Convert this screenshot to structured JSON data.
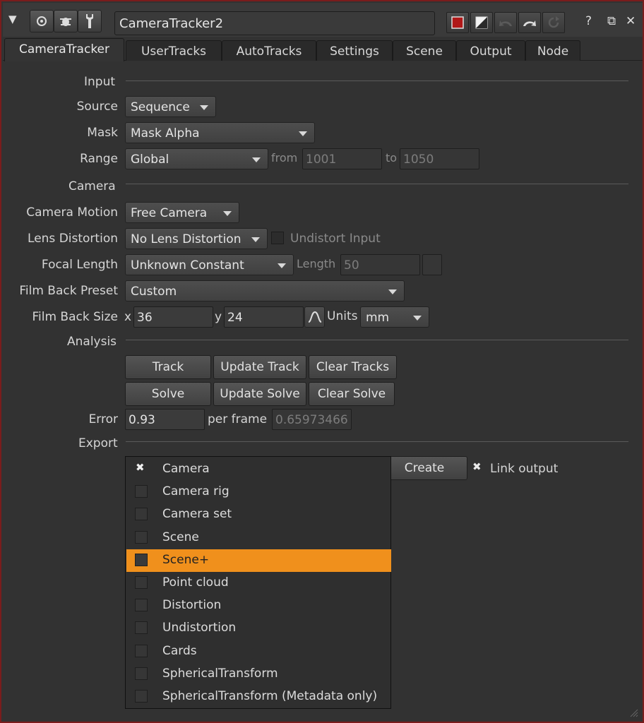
{
  "window": {
    "node_name": "CameraTracker2",
    "help": "?",
    "float": "⧉",
    "close": "✕"
  },
  "tabs": [
    "CameraTracker",
    "UserTracks",
    "AutoTracks",
    "Settings",
    "Scene",
    "Output",
    "Node"
  ],
  "sections": {
    "input": "Input",
    "camera": "Camera",
    "analysis": "Analysis",
    "export": "Export"
  },
  "input": {
    "source_label": "Source",
    "source_value": "Sequence",
    "mask_label": "Mask",
    "mask_value": "Mask Alpha",
    "range_label": "Range",
    "range_value": "Global",
    "from_label": "from",
    "from_value": "1001",
    "to_label": "to",
    "to_value": "1050"
  },
  "camera": {
    "motion_label": "Camera Motion",
    "motion_value": "Free Camera",
    "lens_label": "Lens Distortion",
    "lens_value": "No Lens Distortion",
    "undistort_label": "Undistort Input",
    "focal_label": "Focal Length",
    "focal_value": "Unknown Constant",
    "length_label": "Length",
    "length_value": "50",
    "filmback_preset_label": "Film Back Preset",
    "filmback_preset_value": "Custom",
    "filmback_size_label": "Film Back Size",
    "x_label": "x",
    "x_value": "36",
    "y_label": "y",
    "y_value": "24",
    "units_label": "Units",
    "units_value": "mm"
  },
  "analysis": {
    "track": "Track",
    "update_track": "Update Track",
    "clear_tracks": "Clear Tracks",
    "solve": "Solve",
    "update_solve": "Update Solve",
    "clear_solve": "Clear Solve",
    "error_label": "Error",
    "error_value": "0.93",
    "per_frame_label": "per frame",
    "per_frame_value": "0.65973466"
  },
  "export": {
    "create": "Create",
    "link_output": "Link output",
    "menu_items": [
      {
        "label": "Camera",
        "checked": true,
        "highlighted": false
      },
      {
        "label": "Camera rig",
        "checked": false,
        "highlighted": false
      },
      {
        "label": "Camera set",
        "checked": false,
        "highlighted": false
      },
      {
        "label": "Scene",
        "checked": false,
        "highlighted": false
      },
      {
        "label": "Scene+",
        "checked": false,
        "highlighted": true
      },
      {
        "label": "Point cloud",
        "checked": false,
        "highlighted": false
      },
      {
        "label": "Distortion",
        "checked": false,
        "highlighted": false
      },
      {
        "label": "Undistortion",
        "checked": false,
        "highlighted": false
      },
      {
        "label": "Cards",
        "checked": false,
        "highlighted": false
      },
      {
        "label": "SphericalTransform",
        "checked": false,
        "highlighted": false
      },
      {
        "label": "SphericalTransform (Metadata only)",
        "checked": false,
        "highlighted": false
      }
    ]
  },
  "colors": {
    "highlight": "#f0901c",
    "frame_border": "#7a1c1c"
  }
}
